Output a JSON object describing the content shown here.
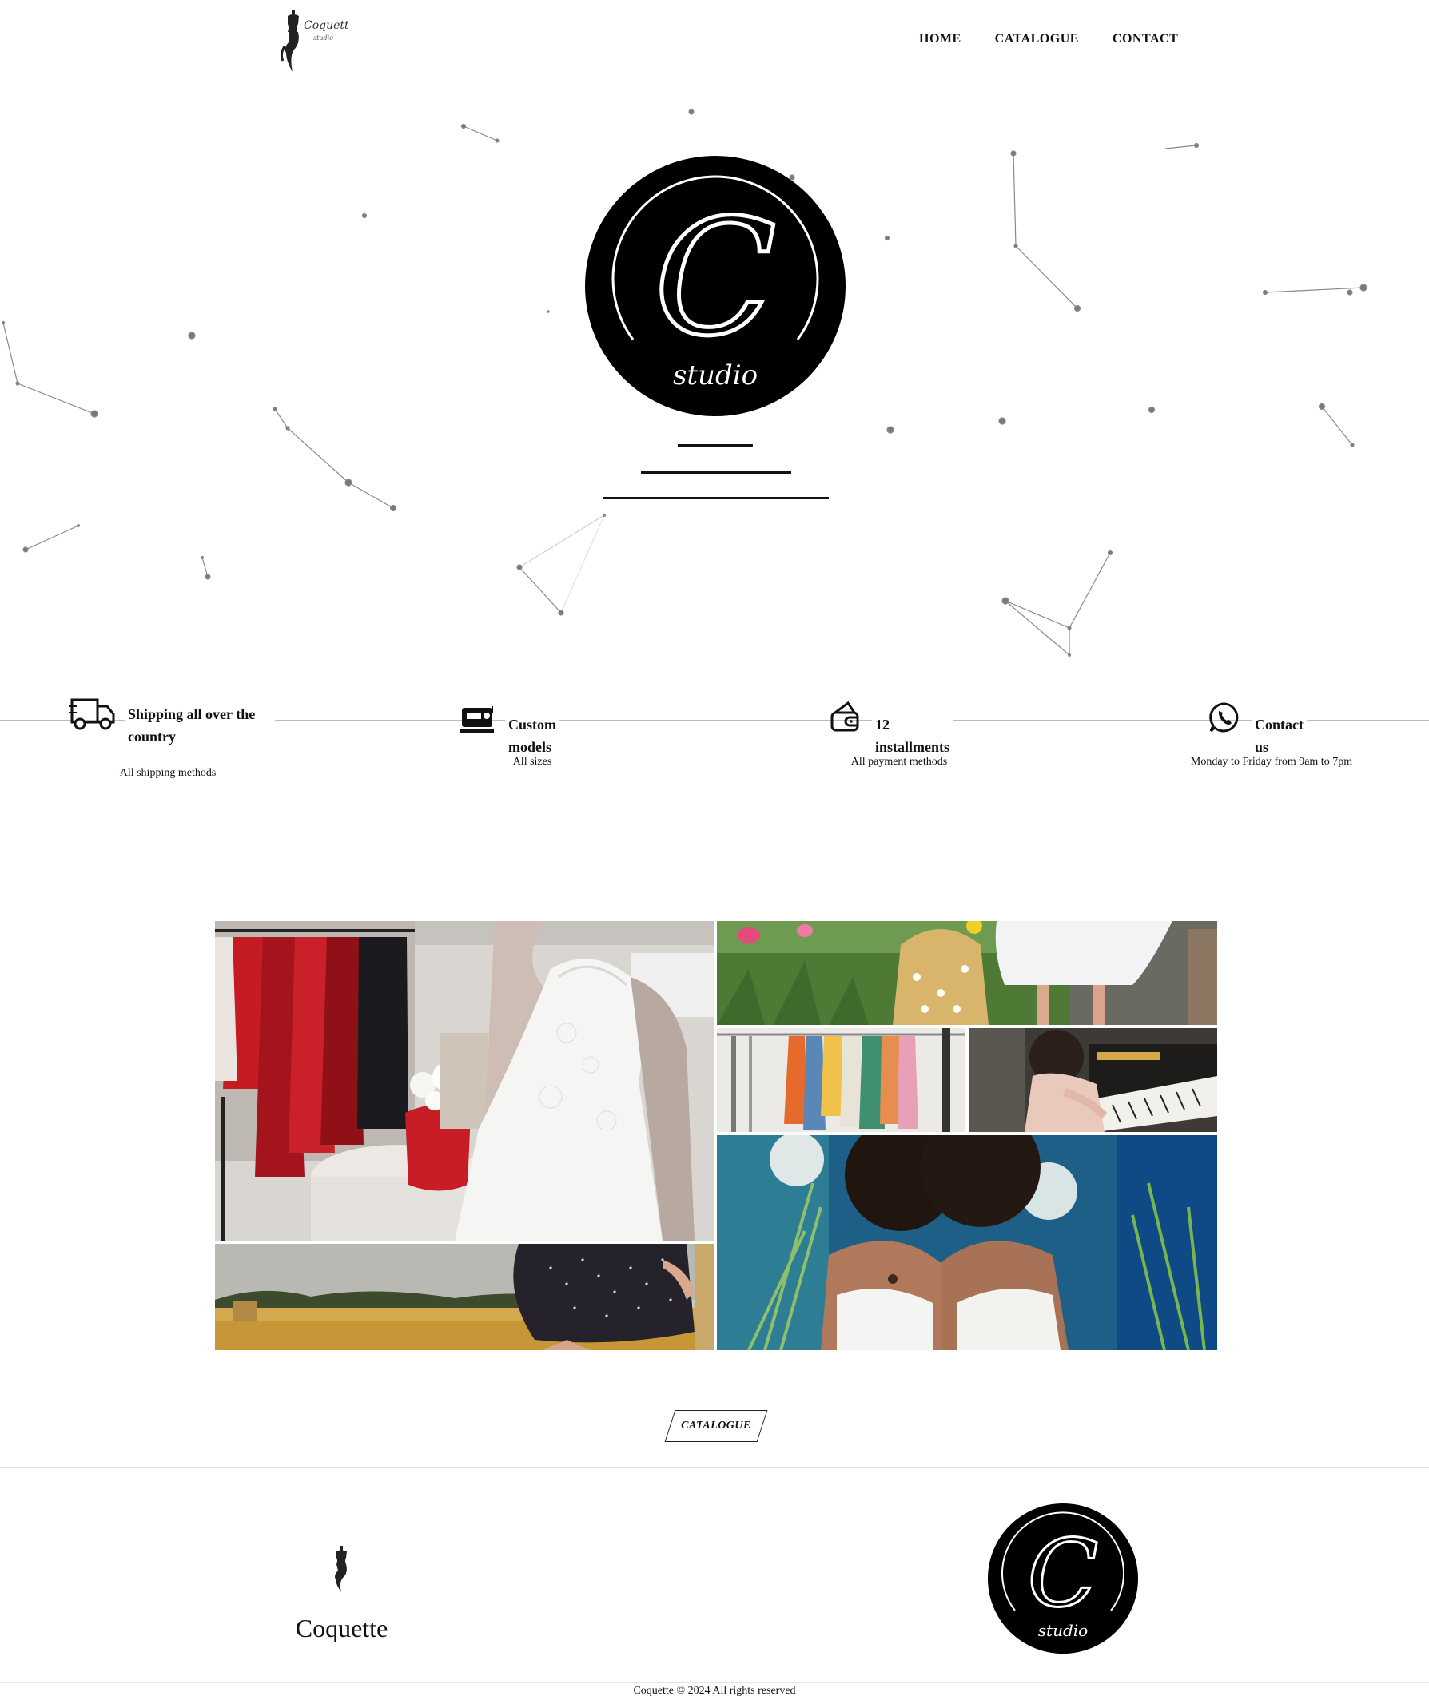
{
  "header": {
    "logo_icon": "mannequin-icon",
    "logo_script": "Coquette",
    "logo_script_sub": "studio",
    "nav": [
      {
        "label": "HOME"
      },
      {
        "label": "CATALOGUE"
      },
      {
        "label": "CONTACT"
      }
    ]
  },
  "hero": {
    "emblem_letter": "C",
    "emblem_word": "studio"
  },
  "features": [
    {
      "icon": "delivery-truck-icon",
      "title_line1": "Shipping all over the",
      "title_line2": "country",
      "subtitle": "All shipping methods"
    },
    {
      "icon": "sewing-machine-icon",
      "title_line1": "Custom models",
      "subtitle": "All sizes"
    },
    {
      "icon": "wallet-icon",
      "title_line1": "12 installments",
      "subtitle": "All payment methods"
    },
    {
      "icon": "whatsapp-icon",
      "title_line1": "Contact us",
      "subtitle": "Monday to Friday from 9am to 7pm"
    }
  ],
  "gallery": {
    "photos": [
      {
        "name": "boutique-mannequin-photo"
      },
      {
        "name": "garden-dress-photo"
      },
      {
        "name": "clothes-rack-photo"
      },
      {
        "name": "piano-photo"
      },
      {
        "name": "two-women-photo"
      },
      {
        "name": "wheat-field-skirt-photo"
      }
    ]
  },
  "catalogue_button": {
    "label": "CATALOGUE"
  },
  "footer": {
    "brand_name": "Coquette",
    "copyright": "Coquette © 2024 All rights reserved"
  },
  "colors": {
    "ink": "#111111",
    "rule": "#bdbdbd",
    "particle": "#7a7a7a"
  }
}
